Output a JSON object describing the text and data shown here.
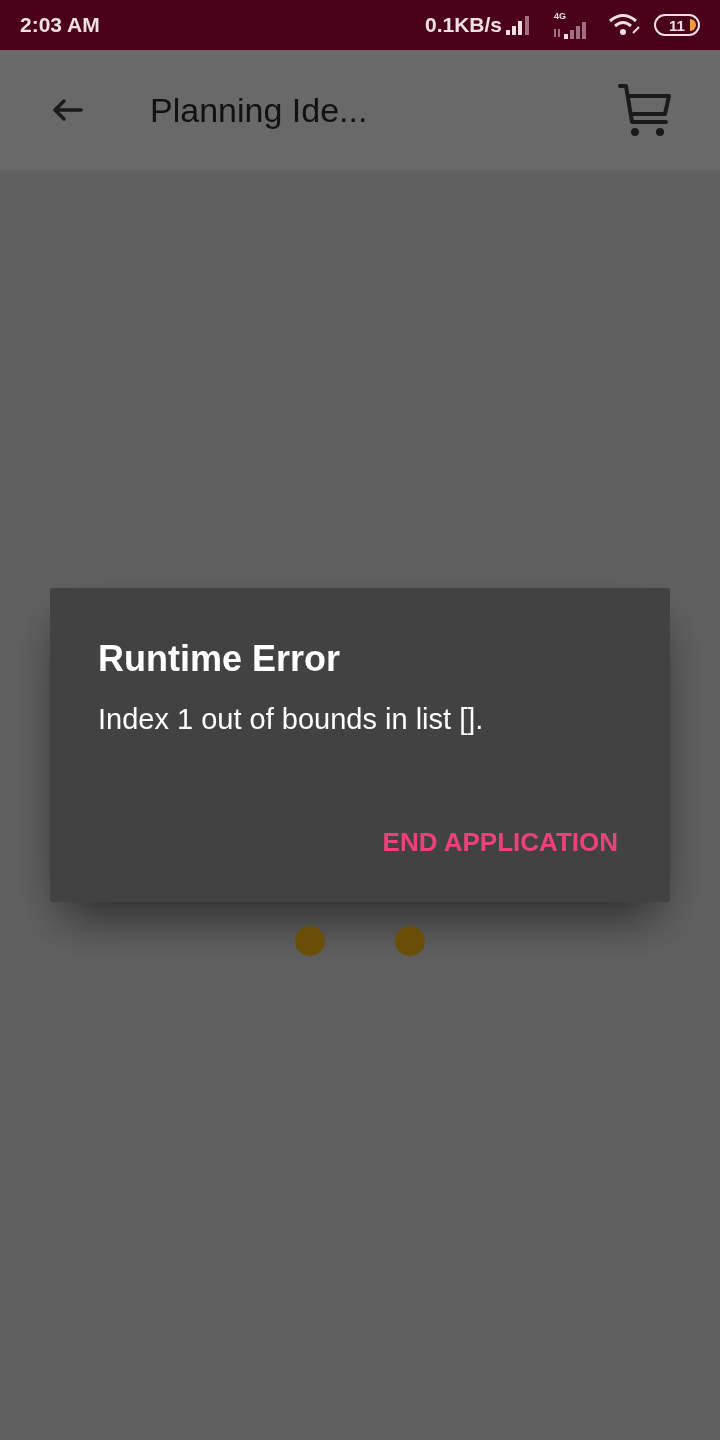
{
  "status_bar": {
    "time": "2:03 AM",
    "speed": "0.1KB/s",
    "network": "4G",
    "battery": "11"
  },
  "app_bar": {
    "title": "Planning Ide..."
  },
  "dialog": {
    "title": "Runtime Error",
    "message": "Index 1 out of bounds in list [].",
    "buttons": [
      "END APPLICATION"
    ]
  }
}
